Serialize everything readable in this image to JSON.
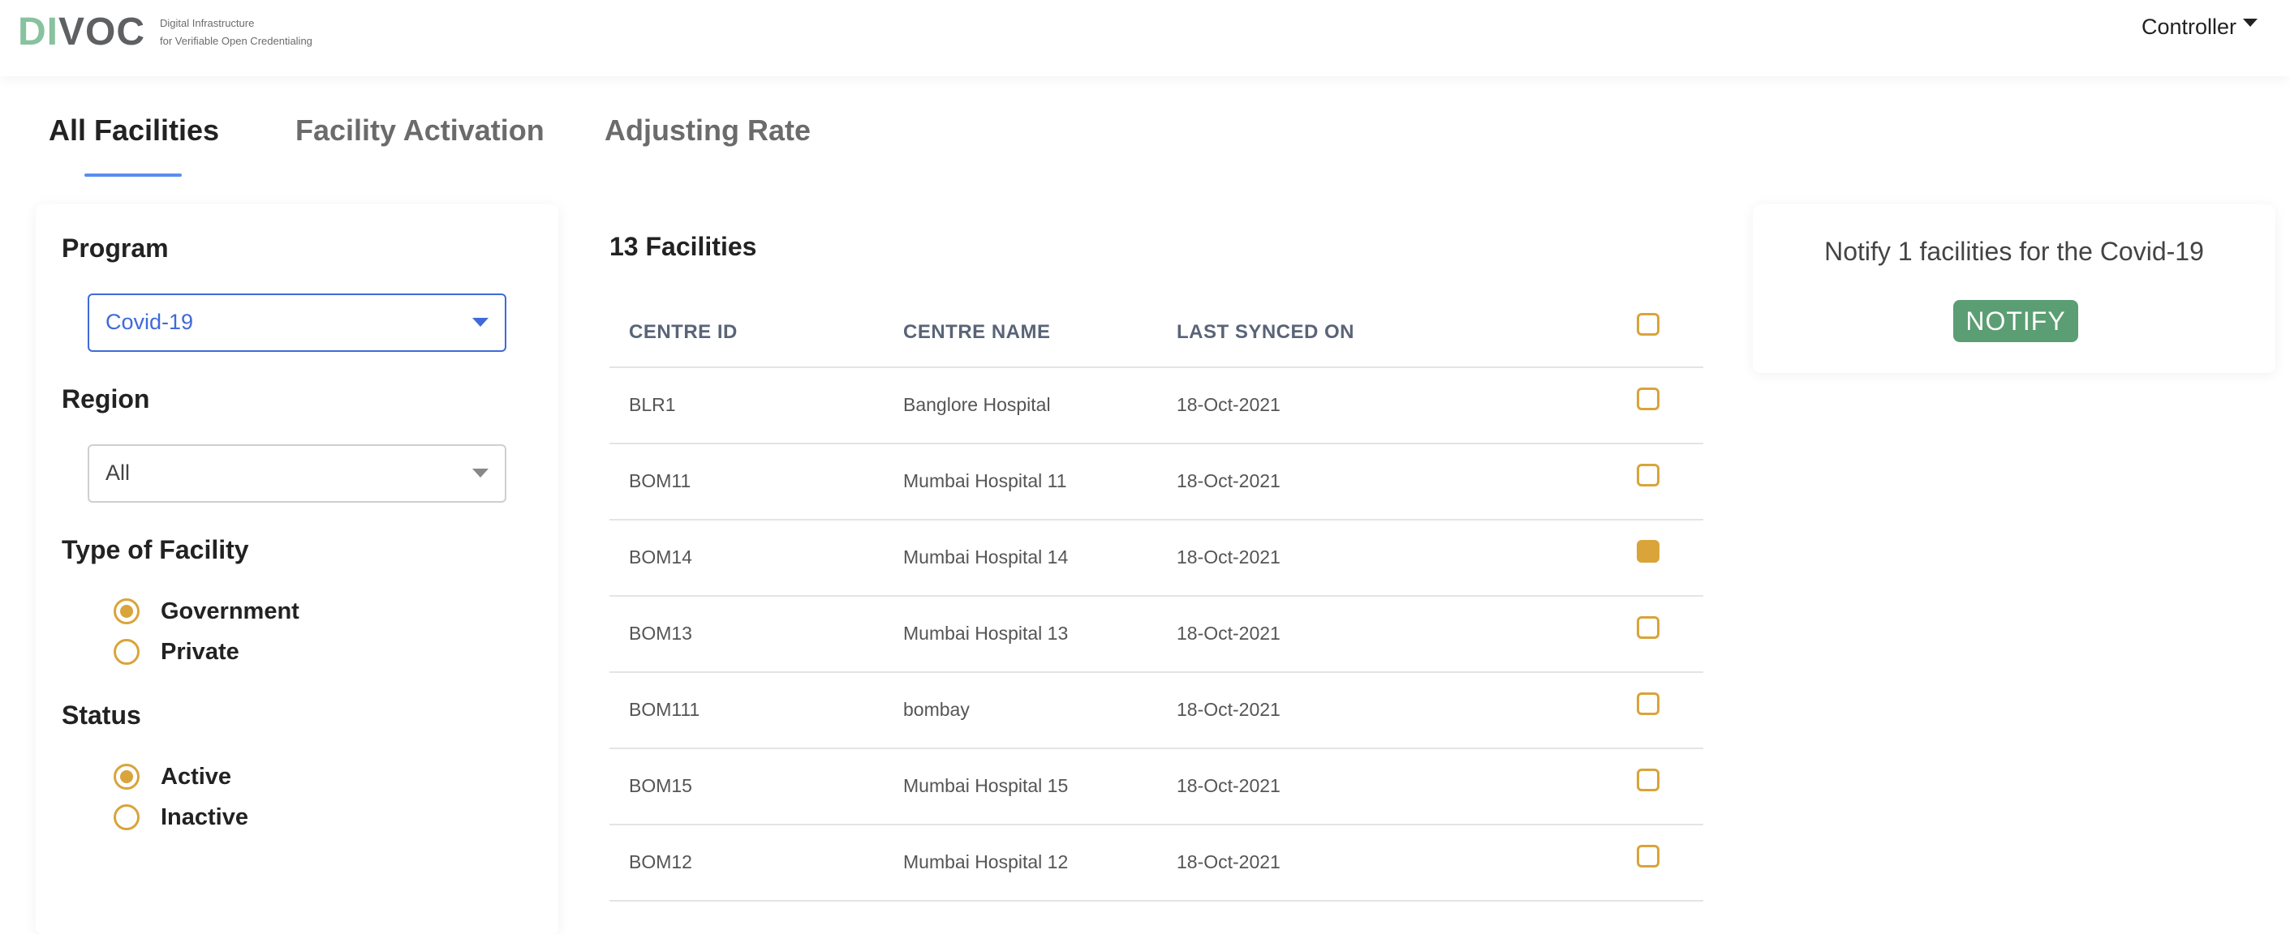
{
  "header": {
    "logo_left": "DI",
    "logo_right": "VOC",
    "tagline_line1": "Digital Infrastructure",
    "tagline_line2": "for Verifiable Open Credentialing",
    "user_menu_label": "Controller"
  },
  "tabs": [
    {
      "label": "All Facilities",
      "active": true
    },
    {
      "label": "Facility Activation",
      "active": false
    },
    {
      "label": "Adjusting Rate",
      "active": false
    }
  ],
  "filters": {
    "program_title": "Program",
    "program_value": "Covid-19",
    "region_title": "Region",
    "region_value": "All",
    "type_title": "Type of Facility",
    "type_options": [
      {
        "label": "Government",
        "checked": true
      },
      {
        "label": "Private",
        "checked": false
      }
    ],
    "status_title": "Status",
    "status_options": [
      {
        "label": "Active",
        "checked": true
      },
      {
        "label": "Inactive",
        "checked": false
      }
    ]
  },
  "table": {
    "count_label": "13 Facilities",
    "headers": [
      "CENTRE ID",
      "CENTRE NAME",
      "LAST SYNCED ON"
    ],
    "rows": [
      {
        "id": "BLR1",
        "name": "Banglore Hospital",
        "synced": "18-Oct-2021",
        "selected": false
      },
      {
        "id": "BOM11",
        "name": "Mumbai Hospital 11",
        "synced": "18-Oct-2021",
        "selected": false
      },
      {
        "id": "BOM14",
        "name": "Mumbai Hospital 14",
        "synced": "18-Oct-2021",
        "selected": true
      },
      {
        "id": "BOM13",
        "name": "Mumbai Hospital 13",
        "synced": "18-Oct-2021",
        "selected": false
      },
      {
        "id": "BOM111",
        "name": "bombay",
        "synced": "18-Oct-2021",
        "selected": false
      },
      {
        "id": "BOM15",
        "name": "Mumbai Hospital 15",
        "synced": "18-Oct-2021",
        "selected": false
      },
      {
        "id": "BOM12",
        "name": "Mumbai Hospital 12",
        "synced": "18-Oct-2021",
        "selected": false
      }
    ]
  },
  "notify": {
    "text": "Notify 1 facilities for the Covid-19",
    "button_label": "NOTIFY"
  },
  "colors": {
    "accent_blue": "#3f6ad8",
    "accent_gold": "#d9a43a",
    "notify_green": "#5b9e73",
    "logo_green": "#88c29e"
  }
}
